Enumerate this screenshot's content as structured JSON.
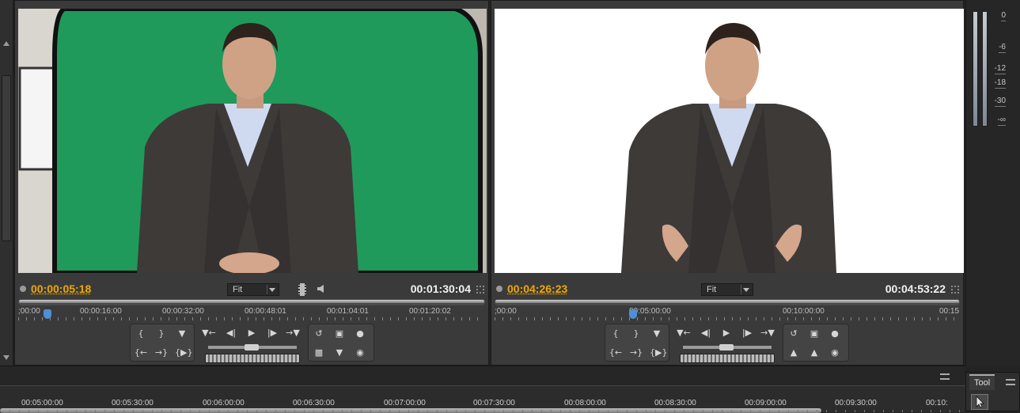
{
  "source_monitor": {
    "current_timecode": "00:00:05:18",
    "duration_timecode": "00:01:30:04",
    "zoom_label": "Fit",
    "ruler_labels": [
      ";00:00",
      "00:00:16:00",
      "00:00:32:00",
      "00:00:48:01",
      "00:01:04:01",
      "00:01:20:02"
    ],
    "playhead_fraction": 0.062,
    "icons": [
      "drag-video-icon",
      "drag-audio-icon"
    ]
  },
  "program_monitor": {
    "current_timecode": "00:04:26:23",
    "duration_timecode": "00:04:53:22",
    "zoom_label": "Fit",
    "ruler_labels": [
      ";00:00",
      "00:05:00:00",
      "00:10:00:00",
      "00:15"
    ],
    "playhead_fraction": 0.296
  },
  "audio_meter": {
    "labels": [
      "0",
      "-6",
      "-12",
      "-18",
      "-30",
      "-∞"
    ]
  },
  "timeline": {
    "ruler_labels": [
      "00:05:00:00",
      "00:05:30:00",
      "00:06:00:00",
      "00:06:30:00",
      "00:07:00:00",
      "00:07:30:00",
      "00:08:00:00",
      "00:08:30:00",
      "00:09:00:00",
      "00:09:30:00",
      "00:10:"
    ]
  },
  "tools_panel": {
    "tab_label": "Tool",
    "selected_tool": "selection-tool"
  },
  "colors": {
    "timecode_accent": "#f0a800",
    "playhead": "#4f8fd6",
    "green_screen": "#1f9a5a"
  }
}
